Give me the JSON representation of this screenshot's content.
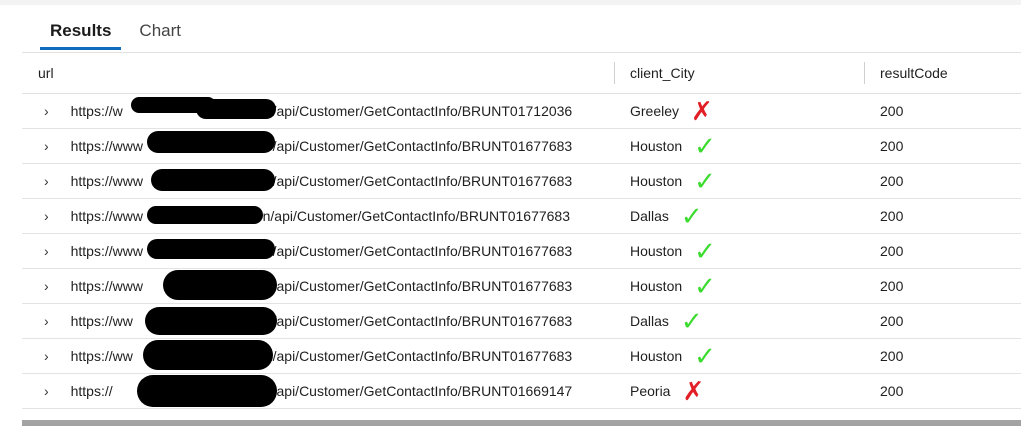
{
  "tabs": [
    {
      "label": "Results",
      "active": true
    },
    {
      "label": "Chart",
      "active": false
    }
  ],
  "columns": {
    "url": "url",
    "city": "client_City",
    "code": "resultCode"
  },
  "rows": [
    {
      "url_prefix": "https://w",
      "url_suffix": "/api/Customer/GetContactInfo/BRUNT01712036",
      "city": "Greeley",
      "mark": "✗",
      "mark_type": "bad",
      "code": "200"
    },
    {
      "url_prefix": "https://www",
      "url_suffix": "/api/Customer/GetContactInfo/BRUNT01677683",
      "city": "Houston",
      "mark": "✓",
      "mark_type": "ok",
      "code": "200"
    },
    {
      "url_prefix": "https://www",
      "url_suffix": "/api/Customer/GetContactInfo/BRUNT01677683",
      "city": "Houston",
      "mark": "✓",
      "mark_type": "ok",
      "code": "200"
    },
    {
      "url_prefix": "https://www",
      "url_suffix": "n/api/Customer/GetContactInfo/BRUNT01677683",
      "city": "Dallas",
      "mark": "✓",
      "mark_type": "ok",
      "code": "200"
    },
    {
      "url_prefix": "https://www",
      "url_suffix": "/api/Customer/GetContactInfo/BRUNT01677683",
      "city": "Houston",
      "mark": "✓",
      "mark_type": "ok",
      "code": "200"
    },
    {
      "url_prefix": "https://www",
      "url_suffix": "/api/Customer/GetContactInfo/BRUNT01677683",
      "city": "Houston",
      "mark": "✓",
      "mark_type": "ok",
      "code": "200"
    },
    {
      "url_prefix": "https://ww",
      "url_suffix": "/api/Customer/GetContactInfo/BRUNT01677683",
      "city": "Dallas",
      "mark": "✓",
      "mark_type": "ok",
      "code": "200"
    },
    {
      "url_prefix": "https://ww",
      "url_suffix": "/api/Customer/GetContactInfo/BRUNT01677683",
      "city": "Houston",
      "mark": "✓",
      "mark_type": "ok",
      "code": "200"
    },
    {
      "url_prefix": "https://",
      "url_suffix": "/api/Customer/GetContactInfo/BRUNT01669147",
      "city": "Peoria",
      "mark": "✗",
      "mark_type": "bad",
      "code": "200"
    }
  ],
  "row_expander_icon": "chevron-right-icon",
  "colors": {
    "accent": "#0f6cbd",
    "check": "#3cdb2f",
    "cross": "#e21f26"
  }
}
